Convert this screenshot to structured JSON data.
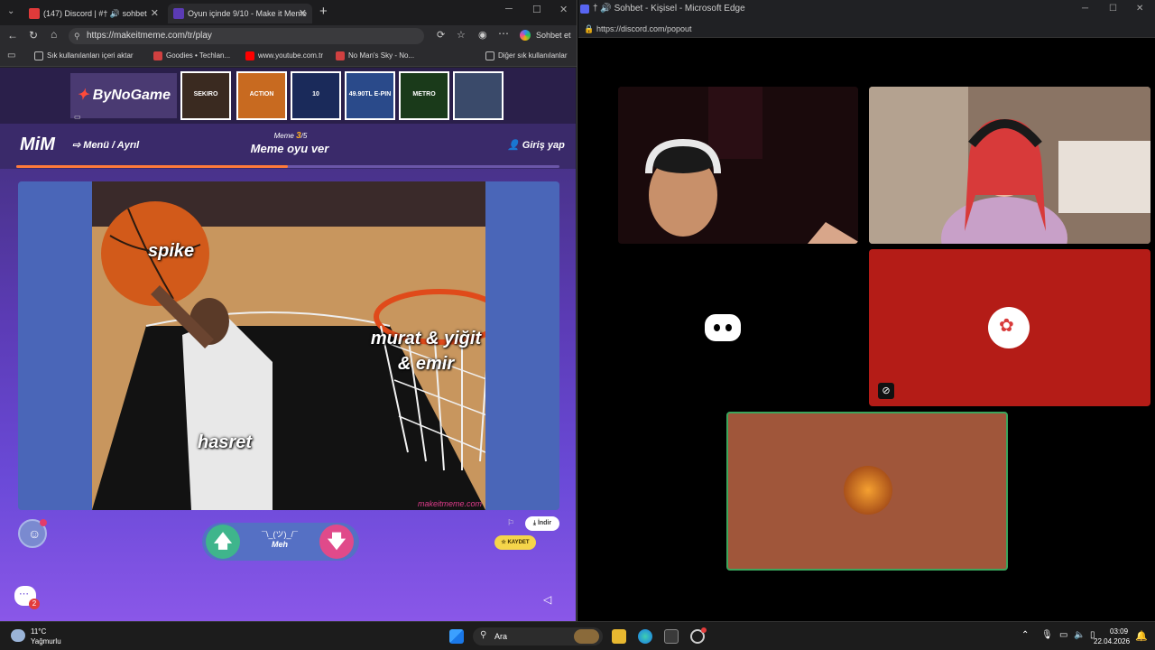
{
  "left_browser": {
    "tabs": [
      {
        "title": "(147) Discord | #† 🔊 sohbet"
      },
      {
        "title": "Oyun içinde 9/10 - Make it Meme"
      }
    ],
    "url": "https://makeitmeme.com/tr/play",
    "account_label": "Sohbet et",
    "bookmarks": [
      {
        "label": "Sık kullanılanları içeri aktar"
      },
      {
        "label": "Goodies • Techlan..."
      },
      {
        "label": "www.youtube.com.tr"
      },
      {
        "label": "No Man's Sky - No..."
      },
      {
        "label": "Diğer sık kullanılanlar"
      }
    ]
  },
  "ad": {
    "brand": "ByNoGame",
    "tiles": [
      {
        "label": "SEKIRO",
        "color": "#3a2a20"
      },
      {
        "label": "ACTION",
        "color": "#c86a20"
      },
      {
        "label": "10",
        "color": "#1a2a5a"
      },
      {
        "label": "49.90TL E-PIN",
        "color": "#2a4a8a"
      },
      {
        "label": "METRO",
        "color": "#1a3a1a"
      },
      {
        "label": "",
        "color": "#3a4a6a"
      }
    ]
  },
  "game": {
    "logo": "MiM",
    "menu_label": "Menü / Ayrıl",
    "login_label": "Giriş yap",
    "meme_prefix": "Meme",
    "meme_index": "3",
    "meme_total": "/5",
    "meme_title": "Meme oyu ver",
    "progress": 0.5,
    "captions": {
      "top": "spike",
      "right": "murat & yiğit & emir",
      "bottom": "hasret"
    },
    "watermark": "makeitmeme.com",
    "vote_face": "¯\\_(ツ)_/¯",
    "vote_label": "Meh",
    "save_label": "KAYDET",
    "download_label": "İndir",
    "chat_badge": "2"
  },
  "discord": {
    "window_title": "† 🔊 Sohbet - Kişisel - Microsoft Edge",
    "url": "https://discord.com/popout",
    "colors": {
      "tile_red": "#b41c17",
      "tile_brown": "#a0563a",
      "speaking": "#3ba55c"
    }
  },
  "taskbar": {
    "weather_temp": "11°C",
    "weather_desc": "Yağmurlu",
    "search_label": "Ara",
    "time": "03:09",
    "date": "22.04.2026"
  }
}
